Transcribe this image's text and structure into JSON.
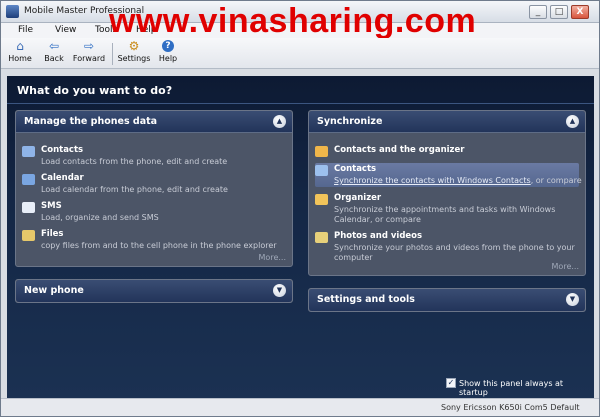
{
  "window": {
    "title": "Mobile Master Professional",
    "watermark": "www.vinasharing.com",
    "controls": {
      "minimize": "_",
      "maximize": "□",
      "close": "X"
    }
  },
  "menu": [
    "File",
    "View",
    "Tools",
    "Help"
  ],
  "toolbar": [
    {
      "label": "Home",
      "icon": "home-icon",
      "glyph": "⌂"
    },
    {
      "label": "Back",
      "icon": "back-arrow-icon",
      "glyph": "⇦"
    },
    {
      "label": "Forward",
      "icon": "forward-arrow-icon",
      "glyph": "⇨"
    },
    {
      "label": "Settings",
      "icon": "settings-icon",
      "glyph": "⚙"
    },
    {
      "label": "Help",
      "icon": "help-icon",
      "glyph": "?"
    }
  ],
  "main": {
    "title": "What do you want to do?",
    "manage": {
      "title": "Manage the phones data",
      "items": [
        {
          "name": "Contacts",
          "desc": "Load contacts from the phone, edit and create",
          "icon": "contacts-icon",
          "color": "#8fb4e8"
        },
        {
          "name": "Calendar",
          "desc": "Load calendar from the phone, edit and create",
          "icon": "calendar-icon",
          "color": "#7aa6e2"
        },
        {
          "name": "SMS",
          "desc": "Load, organize and send SMS",
          "icon": "sms-icon",
          "color": "#e8eef8"
        },
        {
          "name": "Files",
          "desc": "copy files from and to the cell phone in the phone explorer",
          "icon": "files-icon",
          "color": "#e6c86a"
        }
      ],
      "more": "More..."
    },
    "new_phone": {
      "title": "New phone"
    },
    "synchronize": {
      "title": "Synchronize",
      "items": [
        {
          "name": "Contacts and the organizer",
          "desc": "",
          "icon": "sync-organizer-icon",
          "color": "#f0b64a"
        },
        {
          "name": "Contacts",
          "desc_link": "Synchronize the contacts with Windows Contacts",
          "desc_tail": ", or compare",
          "icon": "sync-contacts-icon",
          "color": "#9cc0ee"
        },
        {
          "name": "Organizer",
          "desc": "Synchronize the appointments and tasks with Windows Calendar, or compare",
          "icon": "sync-calendar-icon",
          "color": "#f2c45a"
        },
        {
          "name": "Photos and videos",
          "desc": "Synchronize your photos and videos from the phone to your computer",
          "icon": "photos-icon",
          "color": "#e7d07a"
        }
      ],
      "more": "More..."
    },
    "settings_tools": {
      "title": "Settings and tools"
    },
    "show_panel_label": "Show this panel always at startup",
    "show_panel_checked": true
  },
  "status": {
    "text": "Sony Ericsson K650i  Com5  Default"
  }
}
